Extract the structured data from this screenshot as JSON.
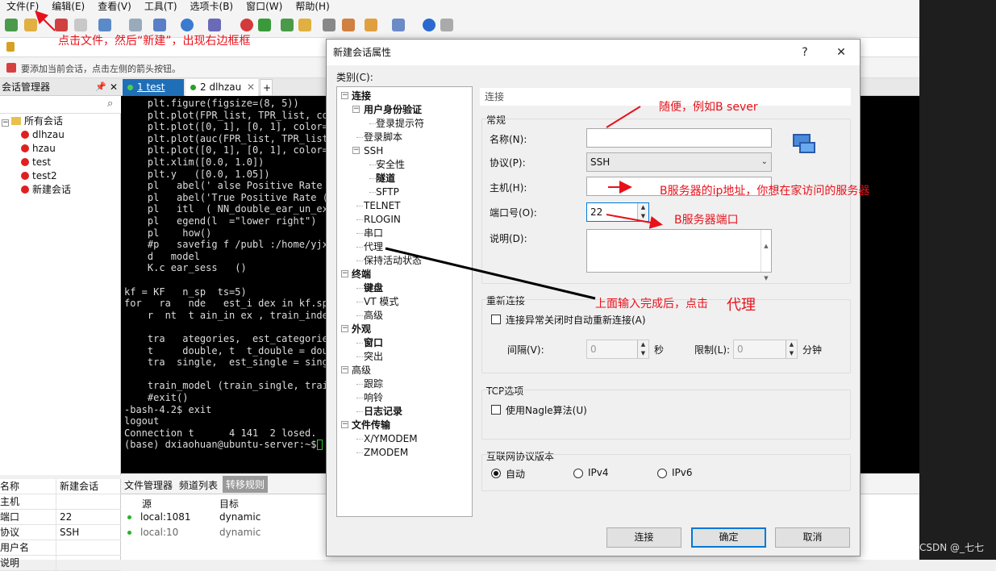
{
  "menubar": [
    "文件(F)",
    "编辑(E)",
    "查看(V)",
    "工具(T)",
    "选项卡(B)",
    "窗口(W)",
    "帮助(H)"
  ],
  "hint_text": "要添加当前会话，点击左侧的箭头按钮。",
  "session_manager": {
    "title": "会话管理器",
    "root": "所有会话",
    "items": [
      "dlhzau",
      "hzau",
      "test",
      "test2",
      "新建会话"
    ]
  },
  "properties": [
    {
      "key": "名称",
      "value": "新建会话"
    },
    {
      "key": "主机",
      "value": ""
    },
    {
      "key": "端口",
      "value": "22"
    },
    {
      "key": "协议",
      "value": "SSH"
    },
    {
      "key": "用户名",
      "value": ""
    },
    {
      "key": "说明",
      "value": ""
    }
  ],
  "tabs": [
    {
      "label": "1 test",
      "active": true
    },
    {
      "label": "2 dlhzau",
      "active": false
    }
  ],
  "terminal_lines": [
    "    plt.figure(figsize=(8, 5))",
    "    plt.plot(FPR_list, TPR_list, col",
    "    plt.plot([0, 1], [0, 1], color='",
    "    plt.plot(auc(FPR_list, TPR_list)",
    "    plt.plot([0, 1], [0, 1], color='",
    "    plt.xlim([0.0, 1.0])",
    "    plt.y   ([0.0, 1.05])",
    "    pl   abel(' alse Positive Rate",
    "    pl   abel('True Positive Rate (",
    "    pl   itl  ( NN_double_ear_un_exp",
    "    pl   egend(l  =\"lower right\")",
    "    pl    how()",
    "    #p   savefig f /publ :/home/yjxi",
    "    d   model",
    "    K.c ear_sess   ()",
    "",
    "kf = KF   n_sp  ts=5)",
    "for   ra   nde   est_i dex in kf.sp",
    "    r  nt  t ain_in ex , train_index",
    "",
    "    tra   ategories,  est_categorie",
    "    t     double, t  t_double = doub",
    "    tra  single,  est_single = sing",
    "",
    "    train_model (train_single, train",
    "    #exit()",
    "-bash-4.2$ exit",
    "logout",
    "Connection t      4 141  2 losed.",
    "(base) dxiaohuan@ubuntu-server:~$ "
  ],
  "bottom_tabs": [
    "文件管理器",
    "频道列表",
    "转移规则"
  ],
  "bottom_table": {
    "headers": [
      "源",
      "目标"
    ],
    "rows": [
      [
        "local:1081",
        "dynamic"
      ],
      [
        "local:10",
        "dynamic"
      ]
    ]
  },
  "dialog": {
    "title": "新建会话属性",
    "help_glyph": "?",
    "close_glyph": "✕",
    "category_label": "类别(C):",
    "categories": [
      {
        "label": "连接",
        "level": 0,
        "bold": true,
        "expander": "−"
      },
      {
        "label": "用户身份验证",
        "level": 1,
        "bold": true,
        "expander": "−"
      },
      {
        "label": "登录提示符",
        "level": 2,
        "bold": false
      },
      {
        "label": "登录脚本",
        "level": 1,
        "bold": false
      },
      {
        "label": "SSH",
        "level": 1,
        "bold": false,
        "expander": "−"
      },
      {
        "label": "安全性",
        "level": 2,
        "bold": false
      },
      {
        "label": "隧道",
        "level": 2,
        "bold": true
      },
      {
        "label": "SFTP",
        "level": 2,
        "bold": false
      },
      {
        "label": "TELNET",
        "level": 1,
        "bold": false
      },
      {
        "label": "RLOGIN",
        "level": 1,
        "bold": false
      },
      {
        "label": "串口",
        "level": 1,
        "bold": false
      },
      {
        "label": "代理",
        "level": 1,
        "bold": false
      },
      {
        "label": "保持活动状态",
        "level": 1,
        "bold": false
      },
      {
        "label": "终端",
        "level": 0,
        "bold": true,
        "expander": "−"
      },
      {
        "label": "键盘",
        "level": 1,
        "bold": true
      },
      {
        "label": "VT 模式",
        "level": 1,
        "bold": false
      },
      {
        "label": "高级",
        "level": 1,
        "bold": false
      },
      {
        "label": "外观",
        "level": 0,
        "bold": true,
        "expander": "−"
      },
      {
        "label": "窗口",
        "level": 1,
        "bold": true
      },
      {
        "label": "突出",
        "level": 1,
        "bold": false
      },
      {
        "label": "高级",
        "level": 0,
        "bold": false,
        "expander": "−"
      },
      {
        "label": "跟踪",
        "level": 1,
        "bold": false
      },
      {
        "label": "响铃",
        "level": 1,
        "bold": false
      },
      {
        "label": "日志记录",
        "level": 1,
        "bold": true
      },
      {
        "label": "文件传输",
        "level": 0,
        "bold": true,
        "expander": "−"
      },
      {
        "label": "X/YMODEM",
        "level": 1,
        "bold": false
      },
      {
        "label": "ZMODEM",
        "level": 1,
        "bold": false
      }
    ],
    "pane_title": "连接",
    "general": {
      "title": "常规",
      "name_label": "名称(N):",
      "name_value": "",
      "protocol_label": "协议(P):",
      "protocol_value": "SSH",
      "host_label": "主机(H):",
      "host_value": "",
      "port_label": "端口号(O):",
      "port_value": "22",
      "desc_label": "说明(D):",
      "desc_value": ""
    },
    "reconnect": {
      "title": "重新连接",
      "checkbox_label": "连接异常关闭时自动重新连接(A)",
      "interval_label": "间隔(V):",
      "interval_value": "0",
      "interval_unit": "秒",
      "limit_label": "限制(L):",
      "limit_value": "0",
      "limit_unit": "分钟"
    },
    "tcp": {
      "title": "TCP选项",
      "checkbox_label": "使用Nagle算法(U)"
    },
    "ipver": {
      "title": "互联网协议版本",
      "options": [
        "自动",
        "IPv4",
        "IPv6"
      ],
      "selected": "自动"
    },
    "buttons": {
      "connect": "连接",
      "ok": "确定",
      "cancel": "取消"
    }
  },
  "annotations": {
    "a1": "点击文件，然后“新建”，出现右边框框",
    "a2": "随便，例如B sever",
    "a3": "B服务器的ip地址，你想在家访问的服务器",
    "a4": "B服务器端口",
    "a5": "上面输入完成后，点击",
    "a6": "代理"
  },
  "watermark": "CSDN @_七七",
  "colors": {
    "annotation": "#e8111b",
    "terminal_bg": "#000000",
    "accent": "#0078d7"
  }
}
